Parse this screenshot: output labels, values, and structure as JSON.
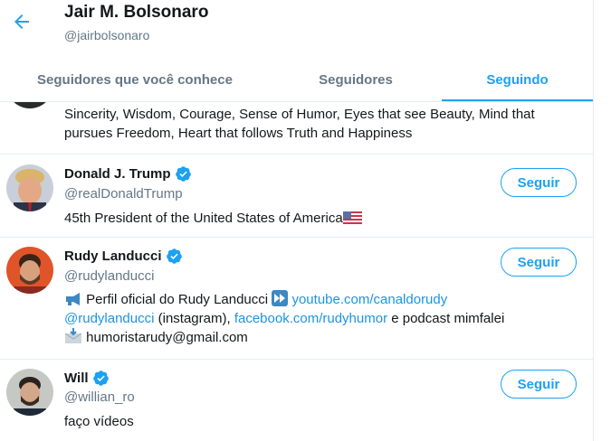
{
  "header": {
    "title": "Jair M. Bolsonaro",
    "handle": "@jairbolsonaro"
  },
  "tabs": [
    {
      "label": "Seguidores que você conhece"
    },
    {
      "label": "Seguidores"
    },
    {
      "label": "Seguindo",
      "active": true
    }
  ],
  "colors": {
    "accent": "#1da1f2",
    "link": "#1b95e0",
    "muted": "#657786"
  },
  "users": [
    {
      "bio": "Sincerity, Wisdom, Courage, Sense of Humor, Eyes that see Beauty, Mind that pursues Freedom, Heart that follows Truth and Happiness"
    },
    {
      "name": "Donald J. Trump",
      "handle": "@realDonaldTrump",
      "verified": true,
      "button": "Seguir",
      "bio": "45th President of the United States of America"
    },
    {
      "name": "Rudy Landucci",
      "handle": "@rudylanducci",
      "verified": true,
      "button": "Seguir",
      "bio_parts": {
        "p1": "Perfil oficial do Rudy Landucci",
        "link1": "youtube.com/canaldorudy",
        "link2": "@rudylanducci",
        "p2": " (instagram), ",
        "link3": "facebook.com/rudyhumor",
        "p3": " e podcast mimfalei",
        "p4": "humoristarudy@gmail.com"
      }
    },
    {
      "name": "Will",
      "handle": "@willian_ro",
      "verified": true,
      "button": "Seguir",
      "bio": "faço vídeos"
    }
  ]
}
